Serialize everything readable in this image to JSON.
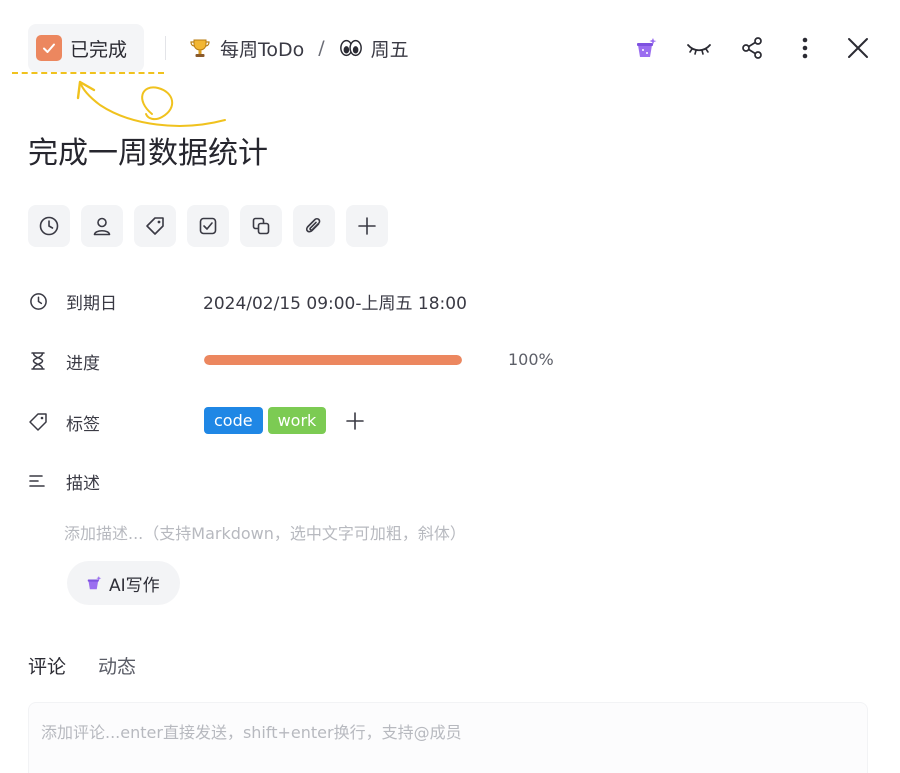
{
  "header": {
    "status_label": "已完成",
    "breadcrumb": {
      "project": "每周ToDo",
      "separator": "/",
      "section": "周五"
    },
    "icons": [
      "magic-hat-icon",
      "hide-eye-icon",
      "share-icon",
      "more-vertical-icon",
      "close-icon"
    ]
  },
  "task": {
    "title": "完成一周数据统计"
  },
  "quick_actions": [
    "clock-icon",
    "person-icon",
    "tag-icon",
    "checkbox-icon",
    "copy-icon",
    "attachment-icon",
    "plus-icon"
  ],
  "fields": {
    "due": {
      "label": "到期日",
      "value": "2024/02/15 09:00-上周五 18:00"
    },
    "progress": {
      "label": "进度",
      "value_text": "100%",
      "value": 1.0
    },
    "tags": {
      "label": "标签",
      "items": [
        {
          "text": "code",
          "color": "#1f87e5"
        },
        {
          "text": "work",
          "color": "#7ccb53"
        }
      ]
    },
    "description": {
      "label": "描述",
      "placeholder": "添加描述...（支持Markdown，选中文字可加粗，斜体）"
    }
  },
  "ai_button": {
    "label": "AI写作"
  },
  "tabs": [
    {
      "label": "评论",
      "active": true
    },
    {
      "label": "动态",
      "active": false
    }
  ],
  "comment": {
    "placeholder": "添加评论...enter直接发送，shift+enter换行，支持@成员"
  },
  "colors": {
    "accent_orange": "#ec875f",
    "annotation_yellow": "#f0c21e",
    "magic_purple": "#9b6ef0"
  }
}
